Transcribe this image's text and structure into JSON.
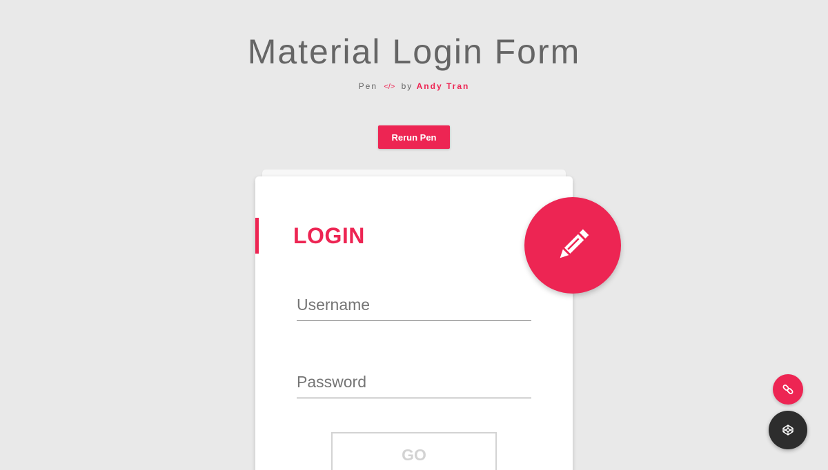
{
  "header": {
    "title": "Material Login Form",
    "byline_prefix": "Pen",
    "byline_code_glyph": "</>",
    "byline_by": "by",
    "author": "Andy Tran"
  },
  "toolbar": {
    "rerun_label": "Rerun Pen"
  },
  "card": {
    "title": "LOGIN",
    "username_placeholder": "Username",
    "password_placeholder": "Password",
    "submit_label": "GO"
  },
  "icons": {
    "edit_fab": "pencil-icon",
    "share_fab": "link-icon",
    "codepen_fab": "codepen-icon"
  },
  "colors": {
    "accent": "#ed2553",
    "background": "#e9e9e9",
    "title_text": "#656565",
    "field_line": "#757575",
    "button_disabled": "#d3d3d3",
    "dark_fab": "#2d2d2d"
  }
}
